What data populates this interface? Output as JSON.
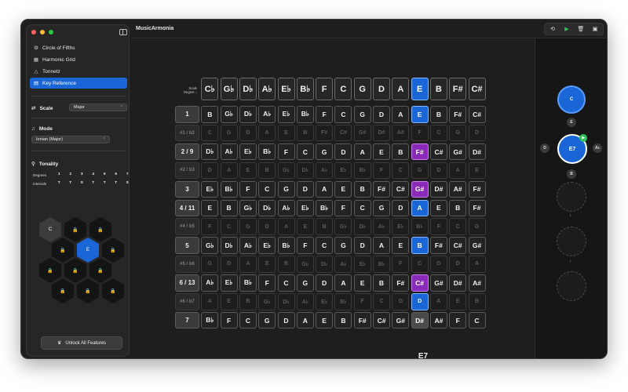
{
  "app": {
    "title": "MusicArmonia"
  },
  "sidebar": {
    "nav": [
      {
        "icon": "settings-icon",
        "label": "Circle of Fifths"
      },
      {
        "icon": "grid-icon",
        "label": "Harmonic Grid"
      },
      {
        "icon": "triangle-icon",
        "label": "Tonnetz"
      },
      {
        "icon": "keyboard-icon",
        "label": "Key Reference"
      }
    ],
    "scale": {
      "label": "Scale",
      "value": "Major"
    },
    "mode": {
      "label": "Mode",
      "value": "Ionian (Major)"
    },
    "tonality": {
      "label": "Tonality",
      "degrees_label": "Degrees",
      "degrees": [
        "1",
        "2",
        "3",
        "4",
        "5",
        "6",
        "7"
      ],
      "intervals_label": "Intervals",
      "intervals": [
        "T",
        "T",
        "S",
        "T",
        "T",
        "T",
        "S"
      ]
    },
    "hex": {
      "c": "C",
      "e": "E"
    },
    "unlock_label": "Unlock All Features"
  },
  "grid": {
    "header_label_line1": "Scale",
    "header_label_line2": "Degree ↓",
    "header": [
      "C♭",
      "G♭",
      "D♭",
      "A♭",
      "E♭",
      "B♭",
      "F",
      "C",
      "G",
      "D",
      "A",
      "E",
      "B",
      "F#",
      "C#"
    ],
    "rows": [
      {
        "degree": "1",
        "dim": false,
        "cells": [
          "B",
          "G♭",
          "D♭",
          "A♭",
          "E♭",
          "B♭",
          "F",
          "C",
          "G",
          "D",
          "A",
          "E",
          "B",
          "F#",
          "C#"
        ]
      },
      {
        "degree": "#1 / b2",
        "dim": true,
        "cells": [
          "C",
          "G",
          "D",
          "A",
          "E",
          "B",
          "F#",
          "C#",
          "G#",
          "D#",
          "A#",
          "F",
          "C",
          "G",
          "D"
        ]
      },
      {
        "degree": "2 / 9",
        "dim": false,
        "cells": [
          "D♭",
          "A♭",
          "E♭",
          "B♭",
          "F",
          "C",
          "G",
          "D",
          "A",
          "E",
          "B",
          "F#",
          "C#",
          "G#",
          "D#"
        ]
      },
      {
        "degree": "#2 / b3",
        "dim": true,
        "cells": [
          "D",
          "A",
          "E",
          "B",
          "G♭",
          "D♭",
          "A♭",
          "E♭",
          "B♭",
          "F",
          "C",
          "G",
          "D",
          "A",
          "E"
        ]
      },
      {
        "degree": "3",
        "dim": false,
        "cells": [
          "E♭",
          "B♭",
          "F",
          "C",
          "G",
          "D",
          "A",
          "E",
          "B",
          "F#",
          "C#",
          "G#",
          "D#",
          "A#",
          "F#"
        ]
      },
      {
        "degree": "4 / 11",
        "dim": false,
        "cells": [
          "E",
          "B",
          "G♭",
          "D♭",
          "A♭",
          "E♭",
          "B♭",
          "F",
          "C",
          "G",
          "D",
          "A",
          "E",
          "B",
          "F#"
        ]
      },
      {
        "degree": "#4 / b5",
        "dim": true,
        "cells": [
          "F",
          "C",
          "G",
          "D",
          "A",
          "E",
          "B",
          "G♭",
          "D♭",
          "A♭",
          "E♭",
          "B♭",
          "F",
          "C",
          "G"
        ]
      },
      {
        "degree": "5",
        "dim": false,
        "cells": [
          "G♭",
          "D♭",
          "A♭",
          "E♭",
          "B♭",
          "F",
          "C",
          "G",
          "D",
          "A",
          "E",
          "B",
          "F#",
          "C#",
          "G#"
        ]
      },
      {
        "degree": "#5 / b6",
        "dim": true,
        "cells": [
          "G",
          "D",
          "A",
          "E",
          "B",
          "G♭",
          "D♭",
          "A♭",
          "E♭",
          "B♭",
          "F",
          "C",
          "G",
          "D",
          "A"
        ]
      },
      {
        "degree": "6 / 13",
        "dim": false,
        "cells": [
          "A♭",
          "E♭",
          "B♭",
          "F",
          "C",
          "G",
          "D",
          "A",
          "E",
          "B",
          "F#",
          "C#",
          "G#",
          "D#",
          "A#"
        ]
      },
      {
        "degree": "#6 / b7",
        "dim": true,
        "cells": [
          "A",
          "E",
          "B",
          "G♭",
          "D♭",
          "A♭",
          "E♭",
          "B♭",
          "F",
          "C",
          "G",
          "D",
          "A",
          "E",
          "B"
        ]
      },
      {
        "degree": "7",
        "dim": false,
        "cells": [
          "B♭",
          "F",
          "C",
          "G",
          "D",
          "A",
          "E",
          "B",
          "F#",
          "C#",
          "G#",
          "D#",
          "A#",
          "F",
          "C"
        ]
      }
    ],
    "highlights": {
      "0-11": "blue",
      "2-11": "purple",
      "4-11": "purple",
      "5-11": "blue",
      "7-11": "blue",
      "9-11": "purple",
      "10-11": "blue",
      "11-11": "grey"
    },
    "selected_column": 11
  },
  "chord": {
    "name": "E7"
  },
  "progression": {
    "first": "C",
    "current": "E7",
    "above": "E",
    "left": "D",
    "right": "A♭",
    "below": "B"
  },
  "colors": {
    "accent": "#1a66d6",
    "highlight": "#8a2ab8",
    "play": "#2fc257",
    "lock": "#e0b400"
  }
}
